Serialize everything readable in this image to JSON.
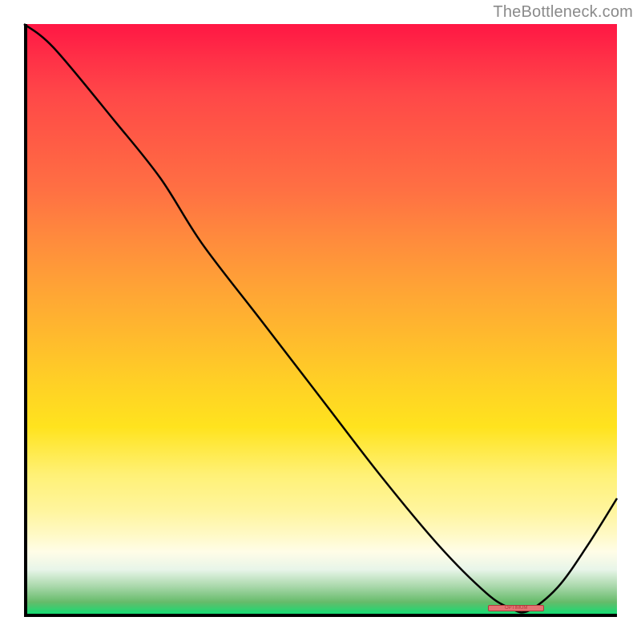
{
  "attribution": "TheBottleneck.com",
  "marker_label": "OPTIMUM",
  "chart_data": {
    "type": "line",
    "title": "",
    "xlabel": "",
    "ylabel": "",
    "xlim": [
      0,
      100
    ],
    "ylim": [
      0,
      100
    ],
    "series": [
      {
        "name": "bottleneck-curve",
        "x": [
          0,
          5,
          15,
          23,
          30,
          40,
          50,
          60,
          70,
          78,
          82,
          85,
          90,
          95,
          100
        ],
        "values": [
          100,
          96,
          84,
          74,
          63,
          50,
          37,
          24,
          12,
          4,
          1.5,
          1,
          5,
          12,
          20
        ]
      }
    ],
    "annotations": [
      {
        "name": "optimum-marker",
        "x": 83,
        "y": 1.5,
        "label": "OPTIMUM"
      }
    ],
    "background_gradient": {
      "stops": [
        {
          "pos": 0.0,
          "color": "#ff1744"
        },
        {
          "pos": 0.5,
          "color": "#ffcf26"
        },
        {
          "pos": 0.86,
          "color": "#fff9c4"
        },
        {
          "pos": 1.0,
          "color": "#00e676"
        }
      ]
    }
  }
}
